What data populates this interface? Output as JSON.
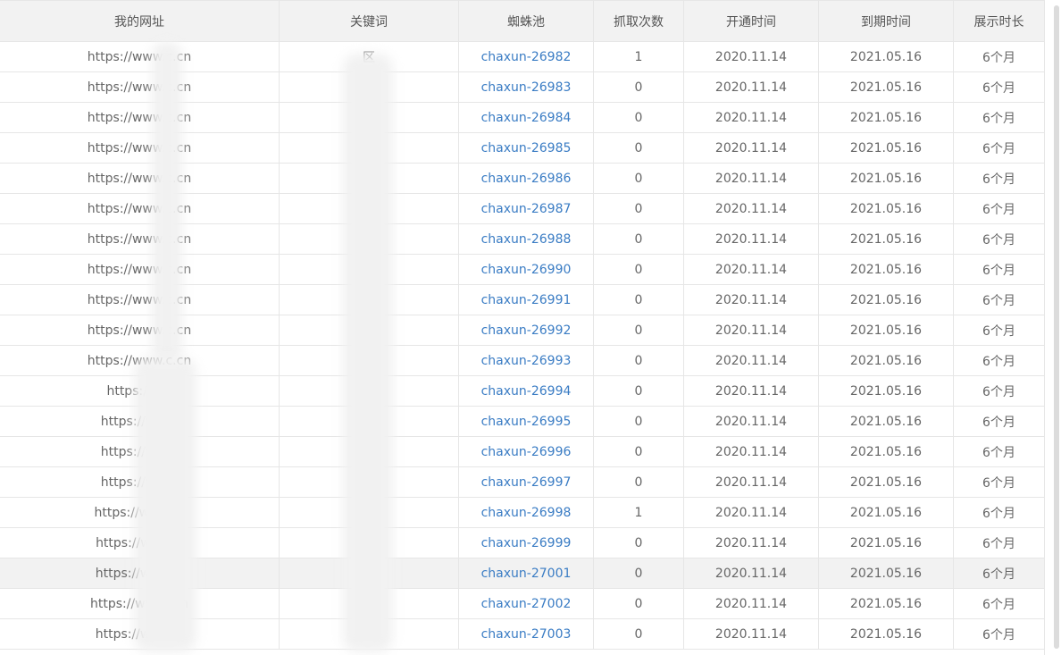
{
  "table": {
    "headers": [
      "我的网址",
      "关键词",
      "蜘蛛池",
      "抓取次数",
      "开通时间",
      "到期时间",
      "展示时长"
    ],
    "rows": [
      {
        "url": "https://www.c.cn",
        "keyword": "区",
        "spider": "chaxun-26982",
        "count": "1",
        "open": "2020.11.14",
        "expire": "2021.05.16",
        "duration": "6个月"
      },
      {
        "url": "https://www.c.cn",
        "keyword": "区",
        "spider": "chaxun-26983",
        "count": "0",
        "open": "2020.11.14",
        "expire": "2021.05.16",
        "duration": "6个月"
      },
      {
        "url": "https://www.c.cn",
        "keyword": "",
        "spider": "chaxun-26984",
        "count": "0",
        "open": "2020.11.14",
        "expire": "2021.05.16",
        "duration": "6个月"
      },
      {
        "url": "https://www.c.cn",
        "keyword": "",
        "spider": "chaxun-26985",
        "count": "0",
        "open": "2020.11.14",
        "expire": "2021.05.16",
        "duration": "6个月"
      },
      {
        "url": "https://www.c.cn",
        "keyword": "V",
        "spider": "chaxun-26986",
        "count": "0",
        "open": "2020.11.14",
        "expire": "2021.05.16",
        "duration": "6个月"
      },
      {
        "url": "https://www.c.cn",
        "keyword": "V",
        "spider": "chaxun-26987",
        "count": "0",
        "open": "2020.11.14",
        "expire": "2021.05.16",
        "duration": "6个月"
      },
      {
        "url": "https://www.c.cn",
        "keyword": "V",
        "spider": "chaxun-26988",
        "count": "0",
        "open": "2020.11.14",
        "expire": "2021.05.16",
        "duration": "6个月"
      },
      {
        "url": "https://www.c.cn",
        "keyword": "",
        "spider": "chaxun-26990",
        "count": "0",
        "open": "2020.11.14",
        "expire": "2021.05.16",
        "duration": "6个月"
      },
      {
        "url": "https://www.c.cn",
        "keyword": "",
        "spider": "chaxun-26991",
        "count": "0",
        "open": "2020.11.14",
        "expire": "2021.05.16",
        "duration": "6个月"
      },
      {
        "url": "https://www.c.cn",
        "keyword": "",
        "spider": "chaxun-26992",
        "count": "0",
        "open": "2020.11.14",
        "expire": "2021.05.16",
        "duration": "6个月"
      },
      {
        "url": "https://www.c.cn",
        "keyword": "",
        "spider": "chaxun-26993",
        "count": "0",
        "open": "2020.11.14",
        "expire": "2021.05.16",
        "duration": "6个月"
      },
      {
        "url": "https://ww",
        "keyword": "V",
        "spider": "chaxun-26994",
        "count": "0",
        "open": "2020.11.14",
        "expire": "2021.05.16",
        "duration": "6个月"
      },
      {
        "url": "https://ww n",
        "keyword": "",
        "spider": "chaxun-26995",
        "count": "0",
        "open": "2020.11.14",
        "expire": "2021.05.16",
        "duration": "6个月"
      },
      {
        "url": "https://ww n",
        "keyword": "",
        "spider": "chaxun-26996",
        "count": "0",
        "open": "2020.11.14",
        "expire": "2021.05.16",
        "duration": "6个月"
      },
      {
        "url": "https://ww n",
        "keyword": "",
        "spider": "chaxun-26997",
        "count": "0",
        "open": "2020.11.14",
        "expire": "2021.05.16",
        "duration": "6个月"
      },
      {
        "url": "https://www. n",
        "keyword": "",
        "spider": "chaxun-26998",
        "count": "1",
        "open": "2020.11.14",
        "expire": "2021.05.16",
        "duration": "6个月"
      },
      {
        "url": "https://www n",
        "keyword": "",
        "spider": "chaxun-26999",
        "count": "0",
        "open": "2020.11.14",
        "expire": "2021.05.16",
        "duration": "6个月"
      },
      {
        "url": "https://ww .cn",
        "keyword": "",
        "spider": "chaxun-27001",
        "count": "0",
        "open": "2020.11.14",
        "expire": "2021.05.16",
        "duration": "6个月"
      },
      {
        "url": "https://www .cn",
        "keyword": "",
        "spider": "chaxun-27002",
        "count": "0",
        "open": "2020.11.14",
        "expire": "2021.05.16",
        "duration": "6个月"
      },
      {
        "url": "https://ww .cn",
        "keyword": "",
        "spider": "chaxun-27003",
        "count": "0",
        "open": "2020.11.14",
        "expire": "2021.05.16",
        "duration": "6个月"
      }
    ],
    "highlighted_row_index": 17
  },
  "colors": {
    "link": "#3a7cc4",
    "header_bg": "#f2f2f2",
    "border": "#e6e6e6",
    "text": "#666666"
  }
}
